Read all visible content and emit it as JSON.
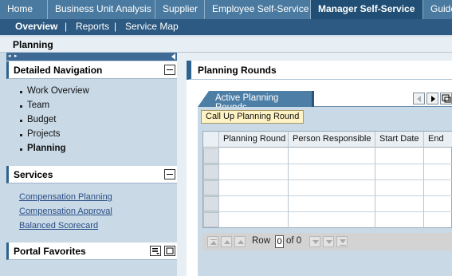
{
  "top_tabs": [
    {
      "label": "Home",
      "active": false
    },
    {
      "label": "Business Unit Analysis",
      "active": false
    },
    {
      "label": "Supplier",
      "active": false
    },
    {
      "label": "Employee Self-Service",
      "active": false
    },
    {
      "label": "Manager Self-Service",
      "active": true
    },
    {
      "label": "Guide",
      "active": false
    }
  ],
  "sub_nav": {
    "items": [
      "Overview",
      "Reports",
      "Service Map"
    ],
    "separator": "|",
    "active": "Overview"
  },
  "page_title": "Planning",
  "detailed_navigation": {
    "title": "Detailed Navigation",
    "items": [
      "Work Overview",
      "Team",
      "Budget",
      "Projects",
      "Planning"
    ],
    "active": "Planning"
  },
  "services": {
    "title": "Services",
    "links": [
      "Compensation Planning",
      "Compensation Approval",
      "Balanced Scorecard"
    ]
  },
  "portal_favorites": {
    "title": "Portal Favorites"
  },
  "content": {
    "title": "Planning Rounds",
    "tab_label": "Active Planning Rounds",
    "call_up_button": "Call Up Planning Round",
    "table": {
      "columns": [
        "Planning Round",
        "Person Responsible",
        "Start Date",
        "End"
      ],
      "rows": [
        [
          "",
          "",
          "",
          ""
        ],
        [
          "",
          "",
          "",
          ""
        ],
        [
          "",
          "",
          "",
          ""
        ],
        [
          "",
          "",
          "",
          ""
        ],
        [
          "",
          "",
          "",
          ""
        ]
      ]
    },
    "pager": {
      "row_label": "Row",
      "current": "0",
      "of_label": "of 0"
    }
  },
  "colors": {
    "header_blue": "#4a7aa0",
    "active_tab": "#204e74",
    "sub_nav": "#2d5a82",
    "panel_bg": "#c9d9e6",
    "link": "#2a4e86",
    "call_up_bg": "#fff3c4"
  }
}
